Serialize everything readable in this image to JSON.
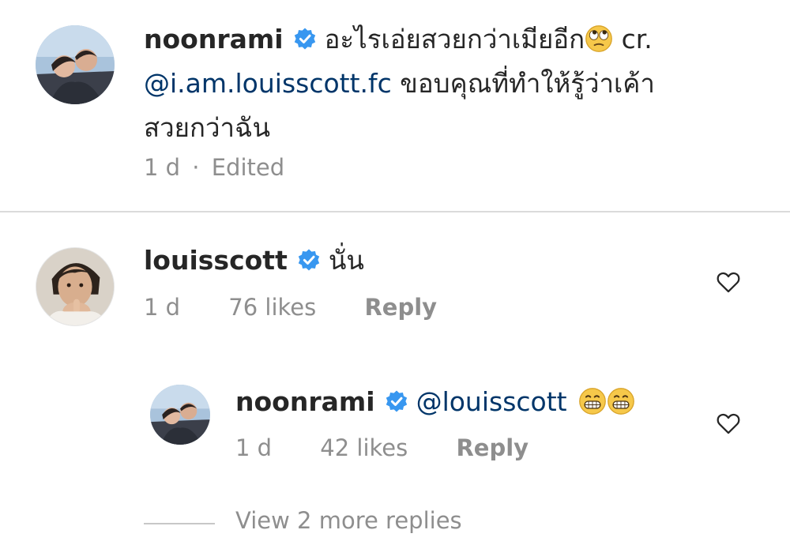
{
  "comments": [
    {
      "username": "noonrami",
      "text_1": "อะไรเอ่ยสวยกว่าเมียอีก",
      "text_2": " cr.",
      "mention": "@i.am.louisscott.fc",
      "text_3": " ขอบคุณที่ทำให้รู้ว่าเค้า",
      "text_4": "สวยกว่าฉัน",
      "time": "1 d",
      "separator": "·",
      "edited": "Edited"
    },
    {
      "username": "louisscott",
      "text": "นั่น",
      "time": "1 d",
      "likes": "76 likes",
      "reply": "Reply"
    }
  ],
  "reply": {
    "username": "noonrami",
    "mention": "@louisscott",
    "time": "1 d",
    "likes": "42 likes",
    "reply": "Reply"
  },
  "view_more": "View 2 more replies",
  "icons": {
    "verified": "verified-badge-icon",
    "heart": "heart-outline-icon",
    "emoji_eyeroll": "face-with-rolling-eyes-icon",
    "emoji_grin": "grinning-face-icon"
  },
  "colors": {
    "verified": "#3897f0",
    "mention": "#003569",
    "meta": "#8e8e8e",
    "divider": "#dbdbdb"
  }
}
